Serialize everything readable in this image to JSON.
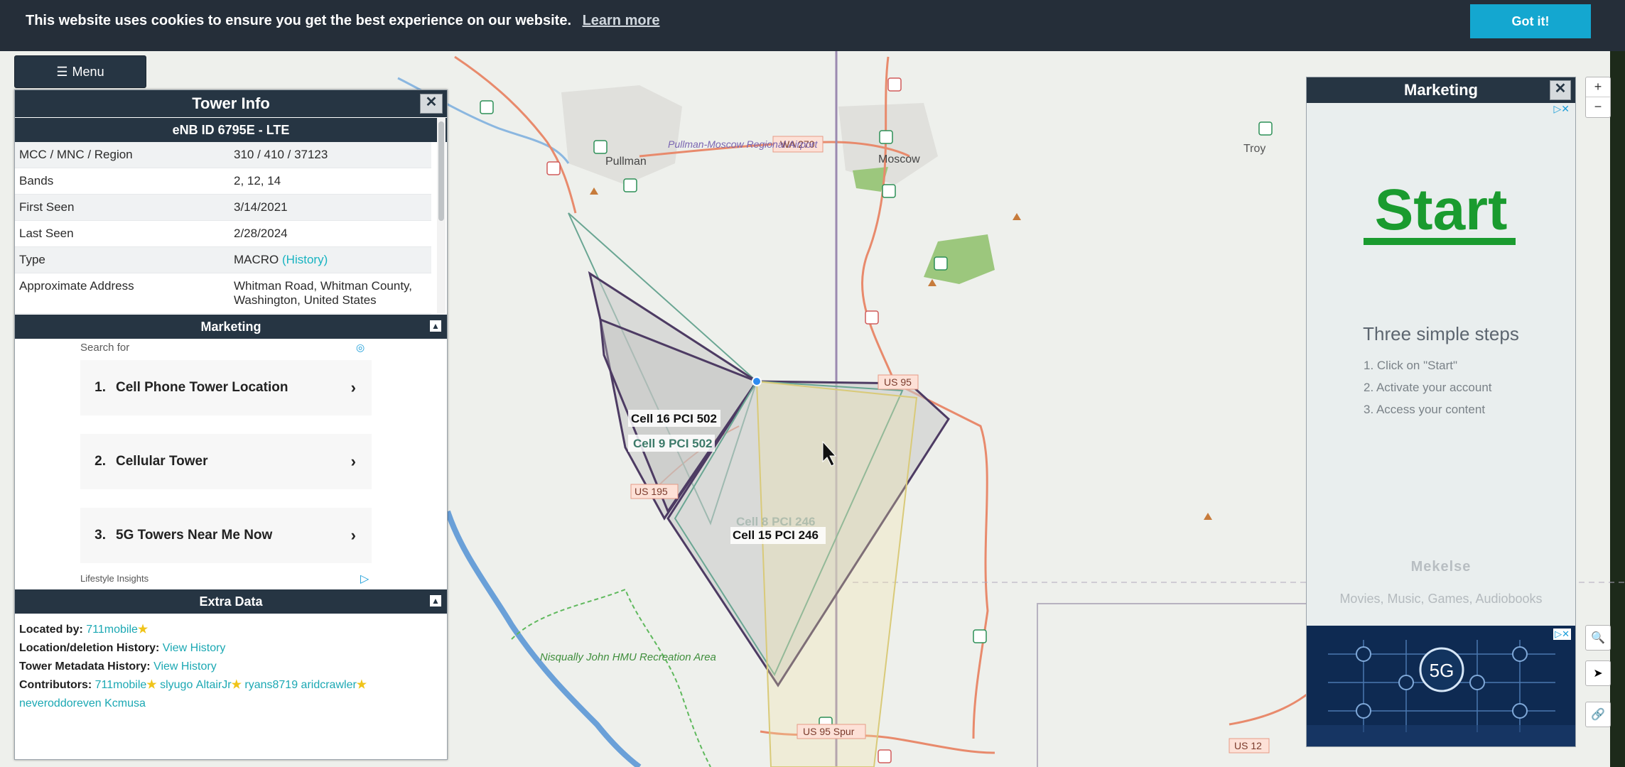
{
  "cookie": {
    "message": "This website uses cookies to ensure you get the best experience on our website.",
    "learn_more": "Learn more",
    "got_it": "Got it!"
  },
  "menu": {
    "label": "Menu"
  },
  "tower_info": {
    "title": "Tower Info",
    "enb": "eNB ID 6795E - LTE",
    "rows": [
      {
        "key": "MCC / MNC / Region",
        "value": "310 / 410 / 37123"
      },
      {
        "key": "Bands",
        "value": "2, 12, 14"
      },
      {
        "key": "First Seen",
        "value": "3/14/2021"
      },
      {
        "key": "Last Seen",
        "value": "2/28/2024"
      },
      {
        "key": "Type",
        "value": "MACRO",
        "link": "(History)"
      },
      {
        "key": "Approximate Address",
        "value": "Whitman Road, Whitman County, Washington, United States"
      }
    ]
  },
  "marketing_left": {
    "title": "Marketing",
    "search_for": "Search for",
    "items": [
      {
        "num": "1.",
        "label": "Cell Phone Tower Location"
      },
      {
        "num": "2.",
        "label": "Cellular Tower"
      },
      {
        "num": "3.",
        "label": "5G Towers Near Me Now"
      }
    ],
    "footer": "Lifestyle Insights"
  },
  "extra": {
    "title": "Extra Data",
    "located_by_label": "Located by:",
    "located_by": "711mobile",
    "location_history_label": "Location/deletion History:",
    "location_history_link": "View History",
    "metadata_label": "Tower Metadata History:",
    "metadata_link": "View History",
    "contributors_label": "Contributors:",
    "contributors": [
      "711mobile",
      "slyugo",
      "AltairJr",
      "ryans8719",
      "aridcrawler",
      "neveroddoreven",
      "Kcmusa"
    ]
  },
  "marketing_right": {
    "title": "Marketing",
    "start": "Start",
    "three_steps": "Three simple steps",
    "steps": [
      "1. Click on \"Start\"",
      "2. Activate your account",
      "3. Access your content"
    ],
    "brand": "Mekelse",
    "brand_sub": "Movies, Music, Games, Audiobooks",
    "banner_text": "5G"
  },
  "map": {
    "labels": {
      "pullman": "Pullman",
      "airport": "Pullman-Moscow Regional Airport",
      "moscow": "Moscow",
      "troy": "Troy",
      "wa270": "WA 270",
      "us95": "US 95",
      "us195": "US 195",
      "us12": "US 12",
      "us95spur": "US 95 Spur",
      "nisqually": "Nisqually John HMU Recreation Area",
      "cell16": "Cell 16 PCI 502",
      "cell9": "Cell 9 PCI 502",
      "cell15": "Cell 15 PCI 246",
      "cell8": "Cell 8 PCI 246"
    }
  },
  "colors": {
    "header": "#263543",
    "accent": "#17b3c1",
    "map_bg": "#eef0ec",
    "start_green": "#1a9b2f"
  },
  "icons": {
    "menu": "hamburger-icon",
    "close": "close-icon",
    "zoom_in": "plus-icon",
    "zoom_out": "minus-icon",
    "search": "magnifier-icon",
    "locate": "location-arrow-icon",
    "link": "link-icon"
  }
}
